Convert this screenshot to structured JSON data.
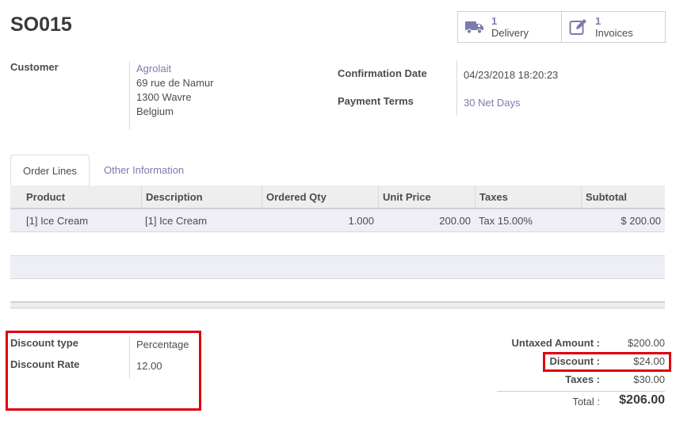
{
  "order": {
    "name": "SO015"
  },
  "smart_buttons": {
    "delivery": {
      "count": "1",
      "label": "Delivery",
      "icon": "truck-icon"
    },
    "invoices": {
      "count": "1",
      "label": "Invoices",
      "icon": "pencil-square-icon"
    }
  },
  "customer": {
    "label": "Customer",
    "name": "Agrolait",
    "address_line1": "69 rue de Namur",
    "address_line2": "1300 Wavre",
    "country": "Belgium"
  },
  "confirmation_date": {
    "label": "Confirmation Date",
    "value": "04/23/2018 18:20:23"
  },
  "payment_terms": {
    "label": "Payment Terms",
    "value": "30 Net Days"
  },
  "tabs": [
    {
      "label": "Order Lines",
      "active": true
    },
    {
      "label": "Other Information",
      "active": false
    }
  ],
  "table": {
    "headers": [
      "Product",
      "Description",
      "Ordered Qty",
      "Unit Price",
      "Taxes",
      "Subtotal"
    ],
    "rows": [
      {
        "product": "[1] Ice Cream",
        "description": "[1] Ice Cream",
        "qty": "1.000",
        "unit_price": "200.00",
        "taxes": "Tax 15.00%",
        "subtotal": "$ 200.00"
      }
    ]
  },
  "discount": {
    "type_label": "Discount type",
    "type_value": "Percentage",
    "rate_label": "Discount Rate",
    "rate_value": "12.00"
  },
  "totals": {
    "untaxed_label": "Untaxed Amount :",
    "untaxed_value": "$200.00",
    "discount_label": "Discount :",
    "discount_value": "$24.00",
    "taxes_label": "Taxes :",
    "taxes_value": "$30.00",
    "total_label": "Total :",
    "total_value": "$206.00"
  },
  "colors": {
    "accent": "#7c7bad",
    "highlight": "#e0000b"
  }
}
